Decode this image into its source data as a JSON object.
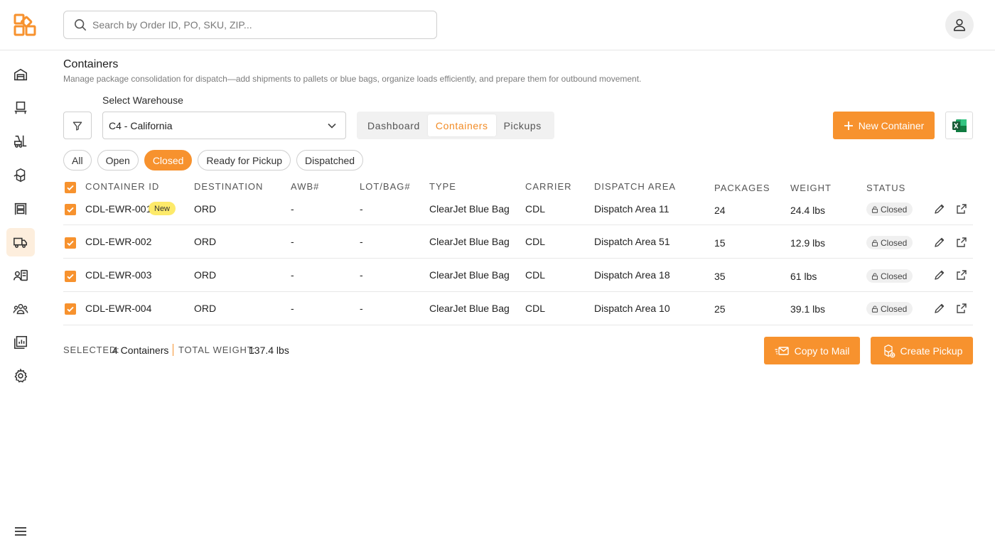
{
  "header": {
    "search_placeholder": "Search by Order ID, PO, SKU, ZIP..."
  },
  "colors": {
    "accent": "#f7922e",
    "accent_text": "#f28b25",
    "new_badge": "#fdea6a"
  },
  "sidebar": {
    "items": [
      {
        "icon": "warehouse-icon"
      },
      {
        "icon": "workstation-icon"
      },
      {
        "icon": "forklift-icon"
      },
      {
        "icon": "boxes-icon"
      },
      {
        "icon": "storage-rack-icon"
      },
      {
        "icon": "delivery-truck-icon",
        "active": true
      },
      {
        "icon": "contact-card-icon"
      },
      {
        "icon": "team-icon"
      },
      {
        "icon": "reports-icon"
      },
      {
        "icon": "settings-icon"
      }
    ],
    "bottom_icon": "hamburger-menu-icon"
  },
  "page": {
    "title": "Containers",
    "subtitle": "Manage package consolidation for dispatch—add shipments to pallets or blue bags, organize loads efficiently, and prepare them for outbound movement."
  },
  "warehouse": {
    "label": "Select Warehouse",
    "selected": "C4 - California"
  },
  "tabs": [
    {
      "label": "Dashboard",
      "active": false
    },
    {
      "label": "Containers",
      "active": true
    },
    {
      "label": "Pickups",
      "active": false
    }
  ],
  "actions": {
    "new_container": "New Container"
  },
  "chips": [
    {
      "label": "All",
      "active": false
    },
    {
      "label": "Open",
      "active": false
    },
    {
      "label": "Closed",
      "active": true
    },
    {
      "label": "Ready for Pickup",
      "active": false
    },
    {
      "label": "Dispatched",
      "active": false
    }
  ],
  "table": {
    "columns": {
      "container_id": "CONTAINER ID",
      "destination": "DESTINATION",
      "awb": "AWB#",
      "lot_bag": "LOT/BAG#",
      "type": "TYPE",
      "carrier": "CARRIER",
      "dispatch_area": "DISPATCH AREA",
      "packages": "PACKAGES",
      "weight": "WEIGHT",
      "status": "STATUS"
    },
    "rows": [
      {
        "id": "CDL-EWR-001",
        "badge": "New",
        "destination": "ORD",
        "awb": "-",
        "lot": "-",
        "type": "ClearJet Blue Bag",
        "carrier": "CDL",
        "area": "Dispatch Area 11",
        "packages": "24",
        "weight": "24.4 lbs",
        "status": "Closed"
      },
      {
        "id": "CDL-EWR-002",
        "badge": "",
        "destination": "ORD",
        "awb": "-",
        "lot": "-",
        "type": "ClearJet Blue Bag",
        "carrier": "CDL",
        "area": "Dispatch Area 51",
        "packages": "15",
        "weight": "12.9 lbs",
        "status": "Closed"
      },
      {
        "id": "CDL-EWR-003",
        "badge": "",
        "destination": "ORD",
        "awb": "-",
        "lot": "-",
        "type": "ClearJet Blue Bag",
        "carrier": "CDL",
        "area": "Dispatch Area 18",
        "packages": "35",
        "weight": "61 lbs",
        "status": "Closed"
      },
      {
        "id": "CDL-EWR-004",
        "badge": "",
        "destination": "ORD",
        "awb": "-",
        "lot": "-",
        "type": "ClearJet Blue Bag",
        "carrier": "CDL",
        "area": "Dispatch Area 10",
        "packages": "25",
        "weight": "39.1 lbs",
        "status": "Closed"
      }
    ]
  },
  "footer": {
    "selected_label": "SELECTED:",
    "selected_value": "4 Containers",
    "total_weight_label": "TOTAL WEIGHT:",
    "total_weight_value": "137.4 lbs",
    "copy_to_mail": "Copy to Mail",
    "create_pickup": "Create Pickup"
  }
}
